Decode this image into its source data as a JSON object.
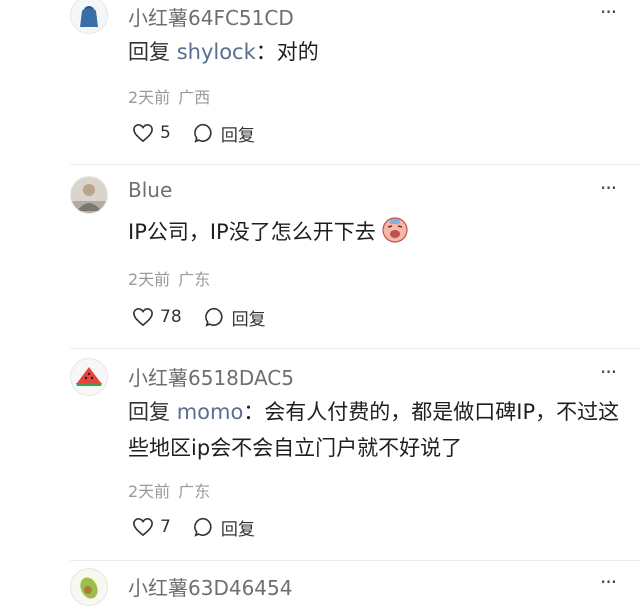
{
  "comments": [
    {
      "avatar": "blue-sweater-avatar",
      "username": "小红薯64FC51CD",
      "reply_prefix": "回复",
      "reply_target": "shylock",
      "reply_sep": "：",
      "text": "对的",
      "time": "2天前",
      "location": "广西",
      "likes": "5",
      "reply_label": "回复"
    },
    {
      "avatar": "photo-avatar",
      "username": "Blue",
      "text": "IP公司，IP没了怎么开下去",
      "time": "2天前",
      "location": "广东",
      "likes": "78",
      "reply_label": "回复"
    },
    {
      "avatar": "watermelon-avatar",
      "username": "小红薯6518DAC5",
      "reply_prefix": "回复",
      "reply_target": "momo",
      "reply_sep": "：",
      "text": "会有人付费的，都是做口碑IP，不过这些地区ip会不会自立门户就不好说了",
      "time": "2天前",
      "location": "广东",
      "likes": "7",
      "reply_label": "回复"
    },
    {
      "avatar": "avocado-avatar",
      "username": "小红薯63D46454"
    }
  ],
  "icons": {
    "more": "more-dots-icon",
    "like": "heart-outline-icon",
    "reply": "speech-bubble-icon",
    "emoji": "crying-face-emoji"
  }
}
